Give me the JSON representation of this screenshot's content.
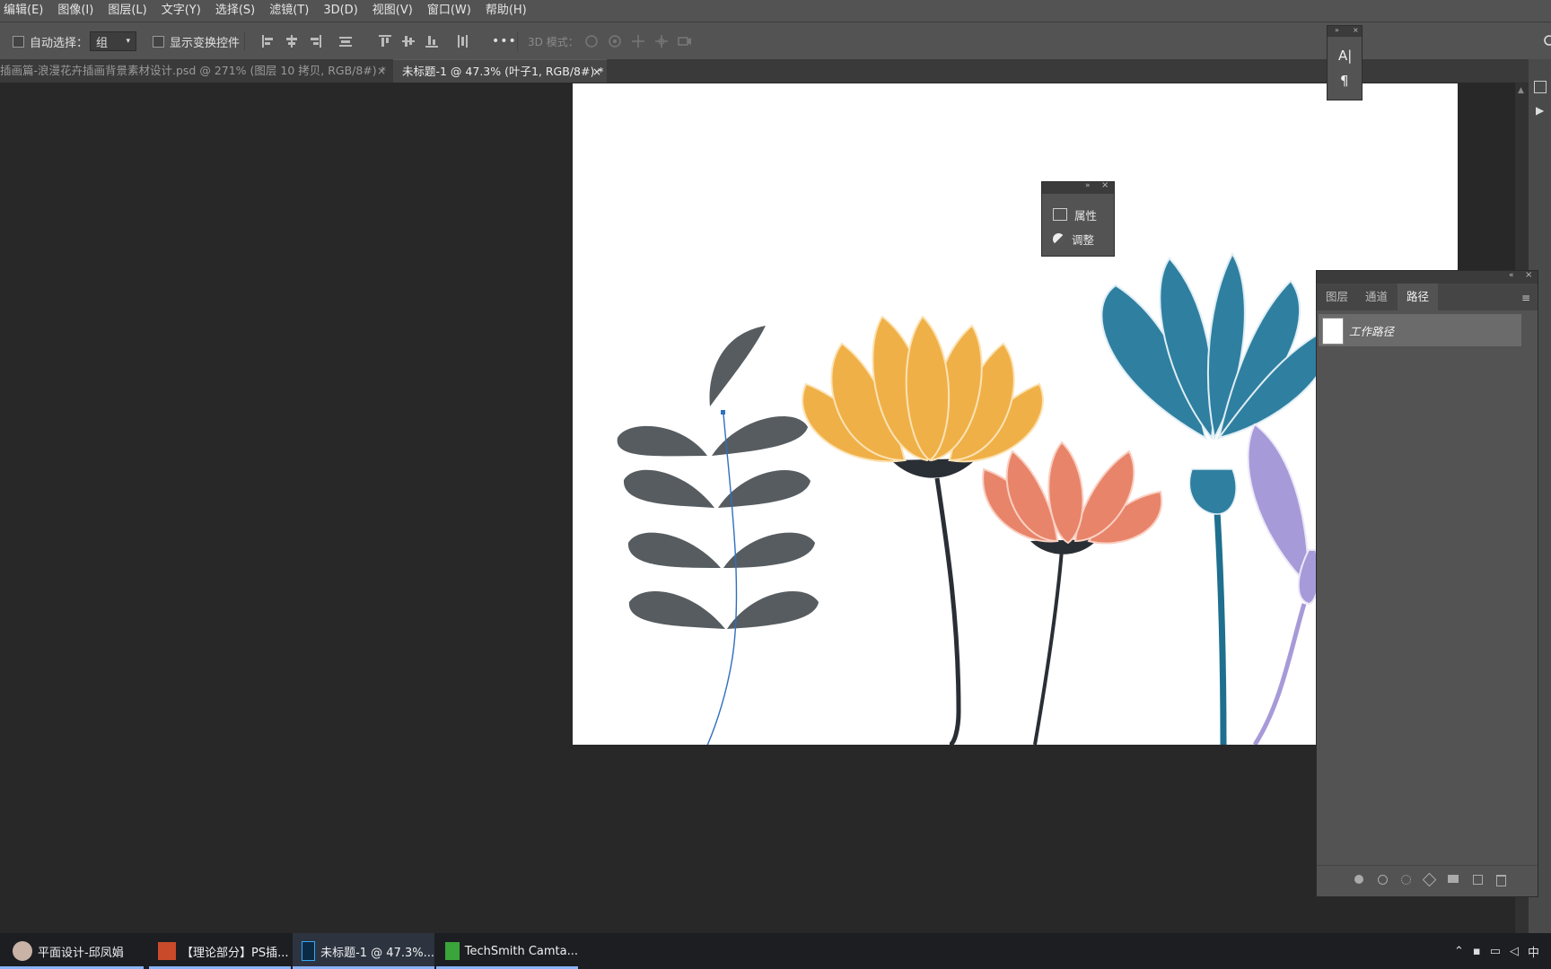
{
  "menu": [
    "编辑(E)",
    "图像(I)",
    "图层(L)",
    "文字(Y)",
    "选择(S)",
    "滤镜(T)",
    "3D(D)",
    "视图(V)",
    "窗口(W)",
    "帮助(H)"
  ],
  "options": {
    "auto_select_label": "自动选择：",
    "auto_select_value": "组",
    "show_transform_label": "显示变换控件",
    "more": "•••",
    "mode3d": "3D 模式："
  },
  "tabs": [
    {
      "label": "插画篇-浪漫花卉插画背景素材设计.psd @ 271% (图层 10 拷贝, RGB/8#) *",
      "close": "×"
    },
    {
      "label": "未标题-1 @ 47.3% (叶子1, RGB/8#) *",
      "close": "×"
    }
  ],
  "mini_panel": {
    "char_glyph": "A|",
    "para_glyph": "¶"
  },
  "float_panel": {
    "properties": "属性",
    "adjust": "调整"
  },
  "paths_panel": {
    "tabs": [
      "图层",
      "通道",
      "路径"
    ],
    "active_tab": "路径",
    "rows": [
      {
        "label": "工作路径"
      }
    ]
  },
  "taskbar": {
    "items": [
      "平面设计-邱凤娟",
      "【理论部分】PS插...",
      "未标题-1 @ 47.3%...",
      "TechSmith Camta..."
    ],
    "tray_lang": "中"
  },
  "colors": {
    "leaf": "#555b5f",
    "orange_flower": "#f0b048",
    "salmon_flower": "#e8846a",
    "teal_flower": "#2f7fa0",
    "purple_flower": "#a79ad8",
    "path_blue": "#2f6fbf"
  }
}
